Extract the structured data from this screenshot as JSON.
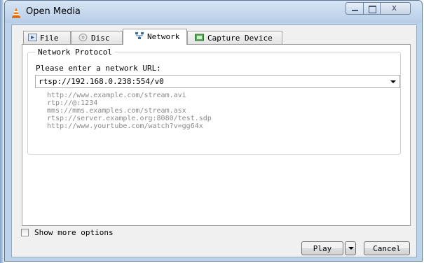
{
  "window": {
    "title": "Open Media",
    "icon": "vlc-cone-icon",
    "accent_color": "#f47a00"
  },
  "controls": {
    "minimize_icon": "minimize-icon",
    "maximize_icon": "maximize-icon",
    "close_glyph": "x"
  },
  "tabs": [
    {
      "label": "File",
      "icon": "file-icon",
      "active": false
    },
    {
      "label": "Disc",
      "icon": "disc-icon",
      "active": false
    },
    {
      "label": "Network",
      "icon": "network-icon",
      "active": true
    },
    {
      "label": "Capture Device",
      "icon": "capture-device-icon",
      "active": false
    }
  ],
  "network": {
    "group_title": "Network Protocol",
    "prompt": "Please enter a network URL:",
    "url_value": "rtsp://192.168.0.238:554/v0",
    "examples": [
      "http://www.example.com/stream.avi",
      "rtp://@:1234",
      "mms://mms.examples.com/stream.asx",
      "rtsp://server.example.org:8080/test.sdp",
      "http://www.yourtube.com/watch?v=gg64x"
    ]
  },
  "options": {
    "show_more_label": "Show more options",
    "checked": false
  },
  "buttons": {
    "play_label": "Play",
    "cancel_label": "Cancel"
  }
}
